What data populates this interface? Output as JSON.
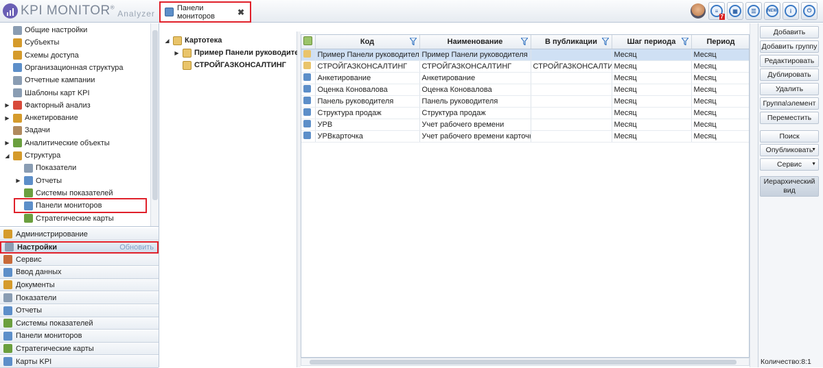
{
  "app": {
    "logo_text": "KPI MONITOR",
    "logo_reg": "®",
    "logo_sub": "Analyzer"
  },
  "tab": {
    "label": "Панели мониторов",
    "close": "✖"
  },
  "toolbar": {
    "badge": "7",
    "new_label": "NEW"
  },
  "tree": [
    {
      "label": "Общие настройки",
      "icon": "gear-icon",
      "color": "#8a9db3",
      "x": 20,
      "arrow": ""
    },
    {
      "label": "Субъекты",
      "icon": "users-icon",
      "color": "#d59b2c",
      "x": 20,
      "arrow": ""
    },
    {
      "label": "Схемы доступа",
      "icon": "key-icon",
      "color": "#d59b2c",
      "x": 20,
      "arrow": ""
    },
    {
      "label": "Организационная структура",
      "icon": "org-icon",
      "color": "#5d8fc9",
      "x": 20,
      "arrow": ""
    },
    {
      "label": "Отчетные кампании",
      "icon": "calendar-icon",
      "color": "#8a9db3",
      "x": 20,
      "arrow": ""
    },
    {
      "label": "Шаблоны карт KPI",
      "icon": "template-icon",
      "color": "#8a9db3",
      "x": 20,
      "arrow": ""
    },
    {
      "label": "Факторный анализ",
      "icon": "chart-icon",
      "color": "#d84a3a",
      "x": 20,
      "arrow": "▶"
    },
    {
      "label": "Анкетирование",
      "icon": "survey-icon",
      "color": "#d59b2c",
      "x": 20,
      "arrow": "▶"
    },
    {
      "label": "Задачи",
      "icon": "tasks-icon",
      "color": "#b08a5e",
      "x": 20,
      "arrow": ""
    },
    {
      "label": "Аналитические объекты",
      "icon": "analytics-icon",
      "color": "#6b9f3e",
      "x": 20,
      "arrow": "▶"
    },
    {
      "label": "Структура",
      "icon": "structure-icon",
      "color": "#d59b2c",
      "x": 20,
      "arrow": "◢"
    },
    {
      "label": "Показатели",
      "icon": "indicators-icon",
      "color": "#8a9db3",
      "x": 36,
      "arrow": ""
    },
    {
      "label": "Отчеты",
      "icon": "reports-icon",
      "color": "#5d8fc9",
      "x": 36,
      "arrow": "▶"
    },
    {
      "label": "Системы показателей",
      "icon": "systems-icon",
      "color": "#6b9f3e",
      "x": 36,
      "arrow": ""
    },
    {
      "label": "Панели мониторов",
      "icon": "monitor-panel-icon",
      "color": "#5d8fc9",
      "x": 36,
      "arrow": "",
      "highlight": true
    },
    {
      "label": "Стратегические карты",
      "icon": "strategy-map-icon",
      "color": "#6b9f3e",
      "x": 36,
      "arrow": ""
    }
  ],
  "nav": [
    {
      "label": "Администрирование",
      "icon": "admin-icon",
      "color": "#d59b2c"
    },
    {
      "label": "Настройки",
      "icon": "settings-icon",
      "color": "#8a9db3",
      "selected": true,
      "extra": "Обновить"
    },
    {
      "label": "Сервис",
      "icon": "service-icon",
      "color": "#c86b3a"
    },
    {
      "label": "Ввод данных",
      "icon": "data-entry-icon",
      "color": "#5d8fc9"
    },
    {
      "label": "Документы",
      "icon": "documents-icon",
      "color": "#d59b2c"
    },
    {
      "label": "Показатели",
      "icon": "indicators-icon",
      "color": "#8a9db3"
    },
    {
      "label": "Отчеты",
      "icon": "reports-icon",
      "color": "#5d8fc9"
    },
    {
      "label": "Системы показателей",
      "icon": "systems-icon",
      "color": "#6b9f3e"
    },
    {
      "label": "Панели мониторов",
      "icon": "monitor-panel-icon",
      "color": "#5d8fc9"
    },
    {
      "label": "Стратегические карты",
      "icon": "strategy-map-icon",
      "color": "#6b9f3e"
    },
    {
      "label": "Карты KPI",
      "icon": "kpi-map-icon",
      "color": "#5d8fc9"
    }
  ],
  "folders": {
    "root": "Картотека",
    "children": [
      "Пример Панели руководителя",
      "СТРОЙГАЗКОНСАЛТИНГ"
    ]
  },
  "grid": {
    "columns": [
      "Код",
      "Наименование",
      "В публикации",
      "Шаг периода",
      "Период"
    ],
    "rows": [
      [
        "Пример Панели руководителя",
        "Пример Панели руководителя",
        "",
        "Месяц",
        "Месяц"
      ],
      [
        "СТРОЙГАЗКОНСАЛТИНГ",
        "СТРОЙГАЗКОНСАЛТИНГ",
        "СТРОЙГАЗКОНСАЛТИНГ",
        "Месяц",
        "Месяц"
      ],
      [
        "Анкетирование",
        "Анкетирование",
        "",
        "Месяц",
        "Месяц"
      ],
      [
        "Оценка Коновалова",
        "Оценка Коновалова",
        "",
        "Месяц",
        "Месяц"
      ],
      [
        "Панель руководителя",
        "Панель руководителя",
        "",
        "Месяц",
        "Месяц"
      ],
      [
        "Структура продаж",
        "Структура продаж",
        "",
        "Месяц",
        "Месяц"
      ],
      [
        "УРВ",
        "Учет рабочего времени",
        "",
        "Месяц",
        "Месяц"
      ],
      [
        "УРВкарточка",
        "Учет рабочего времени карточка",
        "",
        "Месяц",
        "Месяц"
      ]
    ]
  },
  "actions": [
    {
      "label": "Добавить"
    },
    {
      "label": "Добавить группу"
    },
    {
      "label": "Редактировать"
    },
    {
      "label": "Дублировать"
    },
    {
      "label": "Удалить"
    },
    {
      "label": "Группа\\элемент"
    },
    {
      "label": "Переместить"
    },
    {
      "label": "Поиск"
    },
    {
      "label": "Опубликовать",
      "dropdown": true
    },
    {
      "label": "Сервис",
      "dropdown": true
    },
    {
      "label": "Иерархический вид",
      "tall": true
    }
  ],
  "status": {
    "count": "Количество:8:1"
  }
}
